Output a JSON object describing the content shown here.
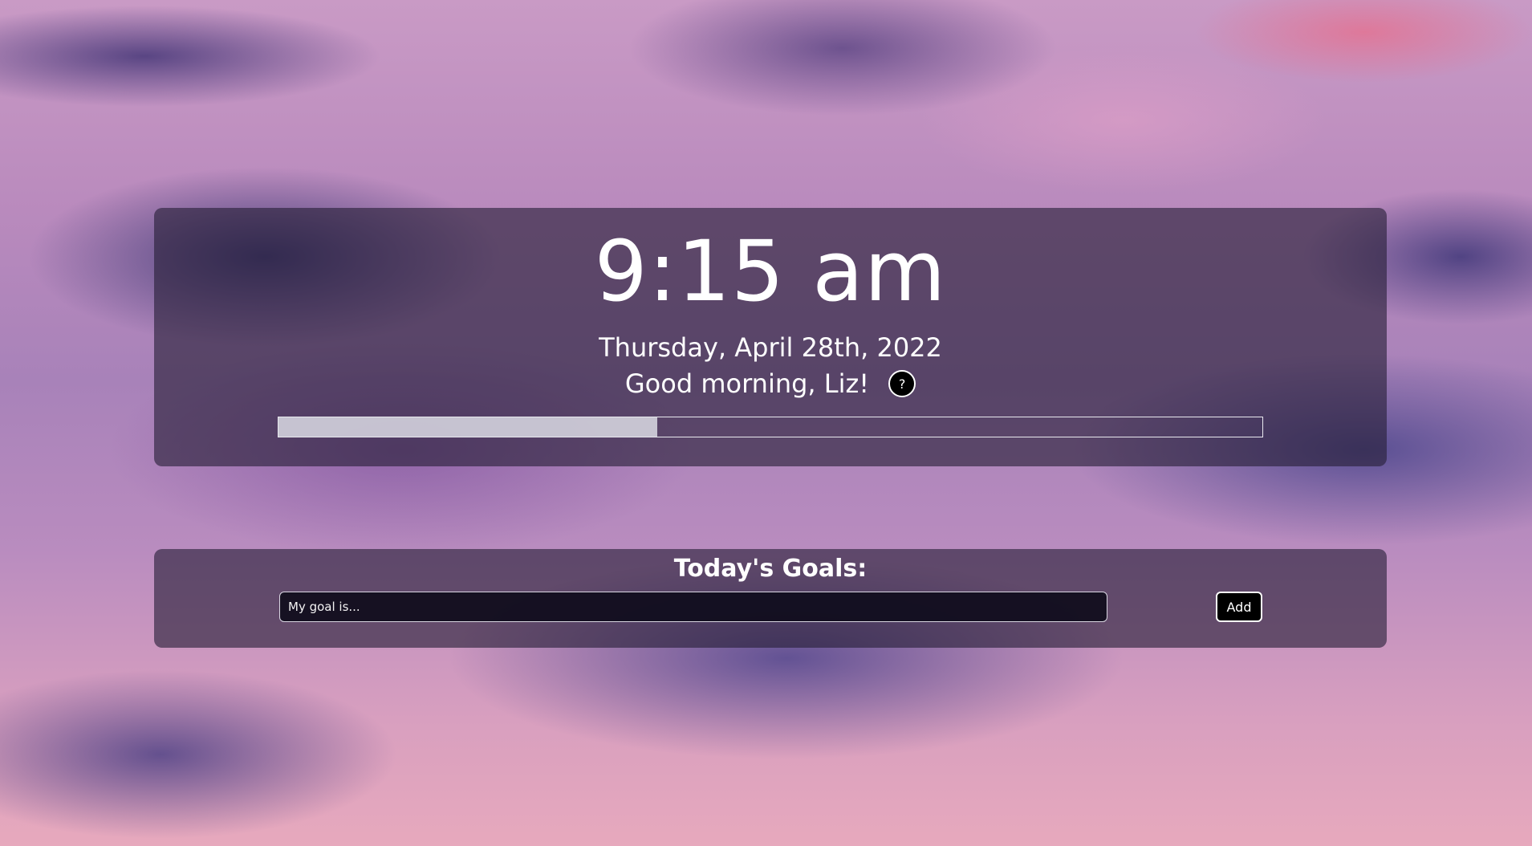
{
  "clock": {
    "time": "9:15 am",
    "date": "Thursday, April 28th, 2022",
    "greeting": "Good morning, Liz!",
    "help_label": "?",
    "day_progress": 0.385
  },
  "goals": {
    "title": "Today's Goals:",
    "input_placeholder": "My goal is...",
    "input_value": "",
    "add_label": "Add"
  },
  "colors": {
    "panel": "#261e37",
    "text": "#ffffff",
    "button_bg": "#000000",
    "progress_fill": "#dadae4"
  },
  "icons": {
    "help": "question-mark-icon"
  }
}
